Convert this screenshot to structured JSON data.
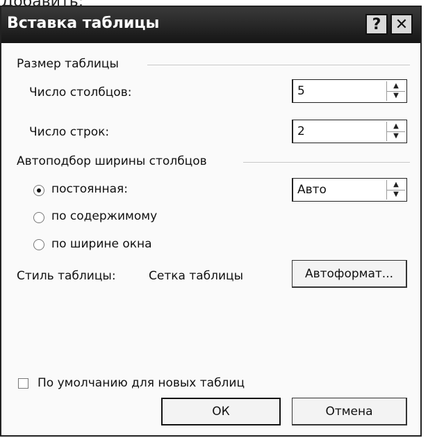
{
  "underlay_text": "Добавить:",
  "window": {
    "title": "Вставка таблицы",
    "help_label": "?",
    "close_label": "✕"
  },
  "table_size": {
    "heading": "Размер таблицы",
    "columns_label": "Число столбцов:",
    "columns_value": "5",
    "rows_label": "Число строк:",
    "rows_value": "2"
  },
  "autofit": {
    "heading": "Автоподбор ширины столбцов",
    "options": [
      {
        "label": "постоянная:",
        "checked": true
      },
      {
        "label": "по содержимому",
        "checked": false
      },
      {
        "label": "по ширине окна",
        "checked": false
      }
    ],
    "fixed_width_value": "Авто"
  },
  "style": {
    "label": "Стиль таблицы:",
    "value": "Сетка таблицы",
    "autoformat_button": "Автоформат..."
  },
  "default_checkbox": {
    "label": "По умолчанию для новых таблиц",
    "checked": false
  },
  "buttons": {
    "ok": "ОК",
    "cancel": "Отмена"
  },
  "icons": {
    "spin_up": "▲",
    "spin_down": "▼"
  }
}
